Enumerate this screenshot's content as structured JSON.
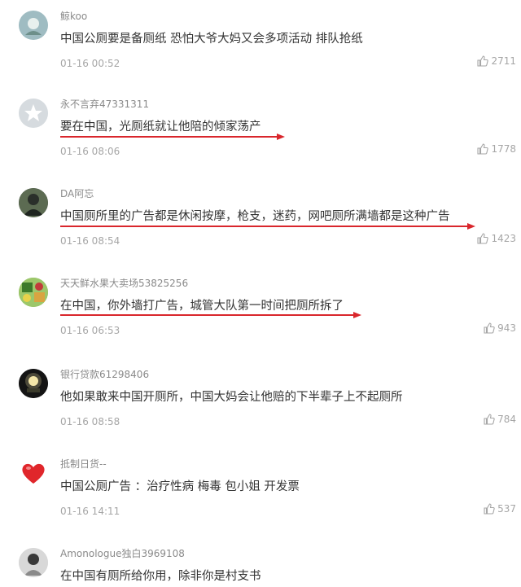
{
  "comments": [
    {
      "username": "鲸koo",
      "text": "中国公厕要是备厕纸 恐怕大爷大妈又会多项活动 排队抢纸",
      "time": "01-16 00:52",
      "likes": "2711"
    },
    {
      "username": "永不言弃47331311",
      "text": "要在中国，光厕纸就让他陪的倾家荡产",
      "time": "01-16 08:06",
      "likes": "1778"
    },
    {
      "username": "DA阿忘",
      "text": "中国厕所里的广告都是休闲按摩，枪支，迷药，网吧厕所满墙都是这种广告",
      "time": "01-16 08:54",
      "likes": "1423"
    },
    {
      "username": "天天鲜水果大卖场53825256",
      "text": "在中国，你外墙打广告，城管大队第一时间把厕所拆了",
      "time": "01-16 06:53",
      "likes": "943"
    },
    {
      "username": "银行贷款61298406",
      "text": "他如果敢来中国开厕所，中国大妈会让他赔的下半辈子上不起厕所",
      "time": "01-16 08:58",
      "likes": "784"
    },
    {
      "username": "抵制日货--",
      "text": "中国公厕广告 ：治疗性病 梅毒 包小姐 开发票",
      "time": "01-16 14:11",
      "likes": "537"
    },
    {
      "username": "Amonologue独白3969108",
      "text": "在中国有厕所给你用，除非你是村支书",
      "time": "",
      "likes": ""
    }
  ],
  "colors": {
    "underline": "#d9262c",
    "username": "#8a8a8a",
    "meta": "#a6a6a6"
  },
  "icons": {
    "like": "thumbs-up-icon"
  }
}
